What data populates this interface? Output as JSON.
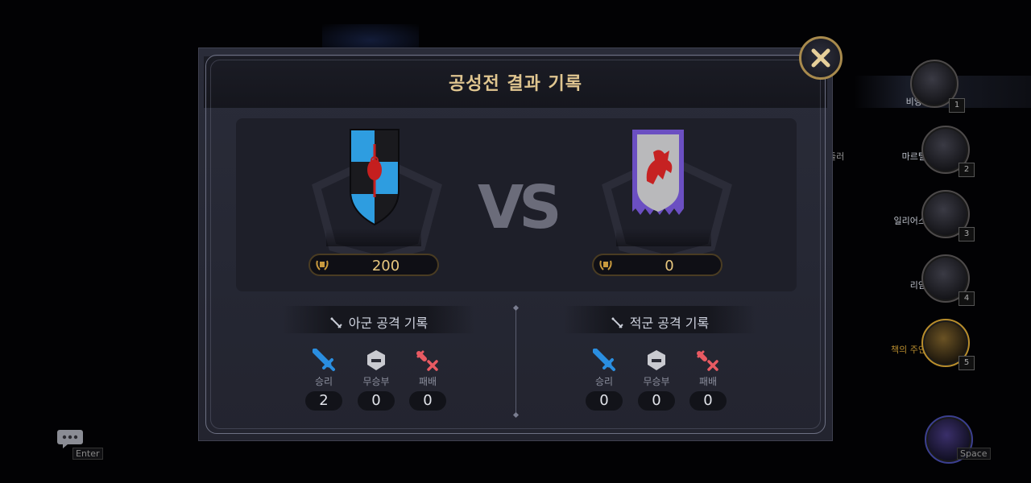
{
  "modal": {
    "title": "공성전 결과 기록",
    "vs_label": "VS",
    "left": {
      "score": "200",
      "record_title": "아군 공격 기록",
      "win_label": "승리",
      "draw_label": "무승부",
      "loss_label": "패배",
      "wins": "2",
      "draws": "0",
      "losses": "0"
    },
    "right": {
      "score": "0",
      "record_title": "적군 공격 기록",
      "win_label": "승리",
      "draw_label": "무승부",
      "loss_label": "패배",
      "wins": "0",
      "draws": "0",
      "losses": "0"
    }
  },
  "party": {
    "members": [
      {
        "name": "비앙카",
        "number": "1"
      },
      {
        "name": "마르텔",
        "number": "2"
      },
      {
        "name": "일리어스",
        "number": "3"
      },
      {
        "name": "리암",
        "number": "4"
      },
      {
        "name": "책의 주인",
        "number": "5"
      }
    ],
    "partial_text": "들러",
    "space_key": "Space"
  },
  "chat": {
    "enter_key": "Enter"
  },
  "colors": {
    "gold": "#e0c690",
    "blue_emblem": "#2e9de0",
    "red_emblem": "#d82a2a",
    "win_icon": "#2a8ee0",
    "loss_icon": "#e85a62"
  }
}
